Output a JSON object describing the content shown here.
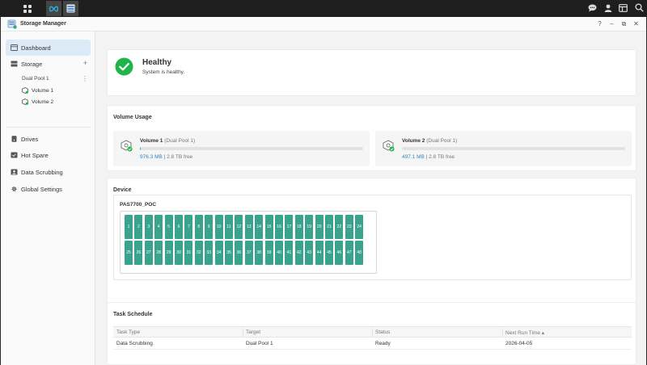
{
  "app": {
    "title": "Storage Manager"
  },
  "window_controls": {
    "help": "?",
    "minimize": "–",
    "restore": "⧉",
    "close": "✕"
  },
  "sidebar": {
    "items": [
      {
        "label": "Dashboard"
      },
      {
        "label": "Storage",
        "action": "+"
      },
      {
        "label": "Drives"
      },
      {
        "label": "Hot Spare"
      },
      {
        "label": "Data Scrubbing"
      },
      {
        "label": "Global Settings"
      }
    ],
    "pool": {
      "label": "Dual Pool 1",
      "menu": "⋮"
    },
    "volumes": [
      {
        "label": "Volume 1"
      },
      {
        "label": "Volume 2"
      }
    ]
  },
  "health": {
    "status": "Healthy",
    "message": "System is healthy."
  },
  "volume_usage": {
    "title": "Volume Usage",
    "volumes": [
      {
        "name": "Volume 1",
        "pool": "(Dual Pool 1)",
        "used": "976.3 MB",
        "free": "| 2.8 TB free",
        "usage_fraction": 0.0004
      },
      {
        "name": "Volume 2",
        "pool": "(Dual Pool 1)",
        "used": "497.1 MB",
        "free": "| 2.8 TB free",
        "usage_fraction": 0.0002
      }
    ]
  },
  "device": {
    "title": "Device",
    "name": "PAS7700_POC",
    "bays": [
      "1",
      "2",
      "3",
      "4",
      "5",
      "6",
      "7",
      "8",
      "9",
      "10",
      "11",
      "12",
      "13",
      "14",
      "15",
      "16",
      "17",
      "18",
      "19",
      "20",
      "21",
      "22",
      "23",
      "24",
      "25",
      "26",
      "27",
      "28",
      "29",
      "30",
      "31",
      "32",
      "33",
      "34",
      "35",
      "36",
      "37",
      "38",
      "39",
      "40",
      "41",
      "42",
      "43",
      "44",
      "45",
      "46",
      "47",
      "48"
    ]
  },
  "task_schedule": {
    "title": "Task Schedule",
    "columns": [
      "Task Type",
      "Target",
      "Status",
      "Next Run Time ▴"
    ],
    "rows": [
      [
        "Data Scrubbing",
        "Dual Pool 1",
        "Ready",
        "2026-04-05"
      ]
    ]
  },
  "colors": {
    "healthy": "#1fb54b",
    "bay": "#3aa38e",
    "accent": "#2f86c9",
    "active_bg": "#dce9f7"
  }
}
